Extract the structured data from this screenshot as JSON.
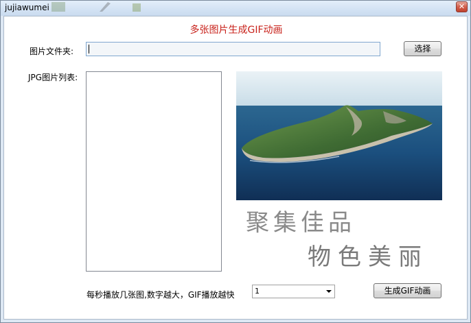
{
  "window": {
    "title": "jujiawumei",
    "close_glyph": "✕"
  },
  "main": {
    "heading": "多张图片生成GIF动画",
    "folder_label": "图片文件夹:",
    "folder_value": "",
    "choose_button": "选择",
    "list_label": "JPG图片列表:",
    "list_items": [],
    "preview": {
      "calligraphy_line1": "聚集佳品",
      "calligraphy_line2": "物色美丽"
    },
    "speed_label": "每秒播放几张图,数字越大，GIF播放越快",
    "speed_value": "1",
    "generate_button": "生成GIF动画"
  },
  "colors": {
    "heading": "#c8211a",
    "window_frame": "#dde8f4",
    "close_button": "#c0412d",
    "sea": "#1b4f7e",
    "island": "#4a7a3b",
    "sky": "#d8e7ef"
  },
  "icons": {
    "close": "close-icon",
    "dropdown": "chevron-down-icon",
    "caret": "text-caret"
  }
}
